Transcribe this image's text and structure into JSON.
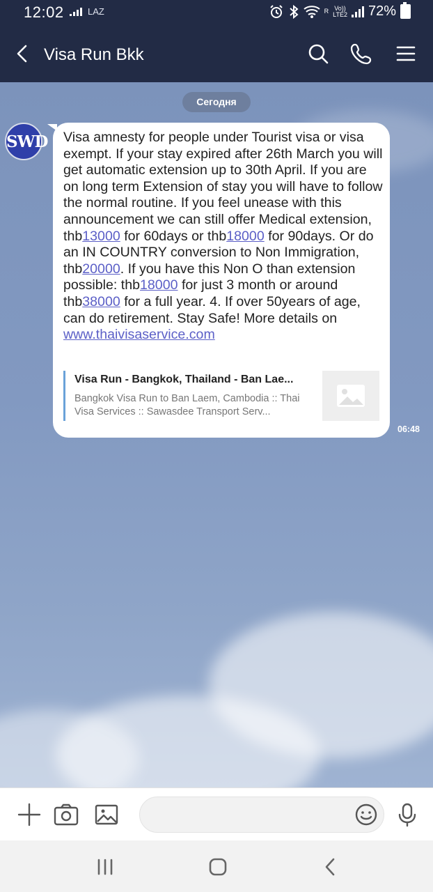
{
  "status_bar": {
    "time": "12:02",
    "carrier_label": "LAZ",
    "volte_label": "Vo))",
    "lte_label": "LTE2",
    "roaming_label": "R",
    "battery": "72%"
  },
  "header": {
    "title": "Visa Run Bkk",
    "icons": [
      "back-arrow-icon",
      "search-icon",
      "phone-icon",
      "menu-icon"
    ]
  },
  "chat": {
    "date_label": "Сегодня",
    "message": {
      "sender_avatar_text": "SWD",
      "segments": [
        {
          "type": "text",
          "text": "Visa amnesty for people under Tourist visa or visa exempt. If your stay expired after 26th March you will get automatic extension up to 30th April. If you are on long term Extension of stay you will have to follow the normal routine. If you feel unease with this announcement we can still offer Medical extension, thb"
        },
        {
          "type": "link",
          "text": "13000"
        },
        {
          "type": "text",
          "text": " for 60days or thb"
        },
        {
          "type": "link",
          "text": "18000"
        },
        {
          "type": "text",
          "text": " for 90days. Or do an IN COUNTRY conversion to Non Immigration, thb"
        },
        {
          "type": "link",
          "text": "20000"
        },
        {
          "type": "text",
          "text": ". If you have this Non O than extension possible: thb"
        },
        {
          "type": "link",
          "text": "18000"
        },
        {
          "type": "text",
          "text": " for just 3 month or around thb"
        },
        {
          "type": "link",
          "text": "38000"
        },
        {
          "type": "text",
          "text": " for a full year. 4. If over 50years of age, can do retirement. Stay Safe! More details on "
        },
        {
          "type": "link",
          "text": "www.thaivisaservice.com"
        }
      ],
      "link_preview": {
        "title": "Visa Run - Bangkok, Thailand - Ban Lae...",
        "description": "Bangkok Visa Run to Ban Laem, Cambodia :: Thai Visa Services :: Sawasdee Transport Serv...",
        "thumbnail_icon": "image-placeholder-icon"
      },
      "time": "06:48"
    }
  },
  "input_bar": {
    "icons": [
      "plus-icon",
      "camera-icon",
      "gallery-icon",
      "emoji-icon",
      "mic-icon"
    ],
    "placeholder": ""
  },
  "nav_bar": {
    "icons": [
      "recent-apps-icon",
      "home-icon",
      "back-icon"
    ]
  },
  "colors": {
    "header_bg": "#222b45",
    "chat_bg": "#8299c1",
    "link": "#5b5fc7",
    "avatar_bg": "#2f3fa9"
  }
}
